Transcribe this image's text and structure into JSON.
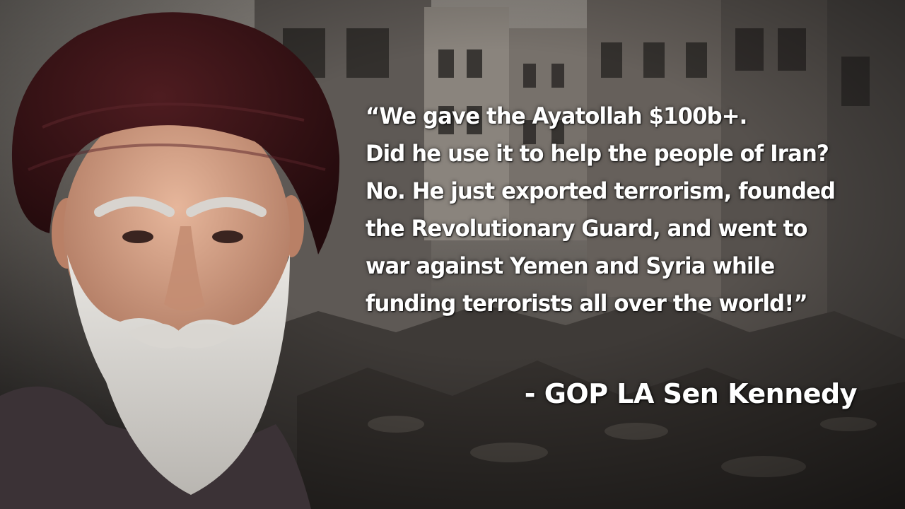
{
  "quote": {
    "lines": [
      "“We gave the Ayatollah $100b+.",
      "Did he use it to help the people of Iran?",
      "No. He just exported terrorism, founded",
      "the Revolutionary Guard, and went to",
      "war against Yemen and Syria while",
      "funding terrorists all over the world!”"
    ]
  },
  "attribution": "- GOP LA Sen Kennedy",
  "colors": {
    "text": "#ffffff",
    "turban": "#3a1216",
    "background_rubble": "#4a4643"
  }
}
